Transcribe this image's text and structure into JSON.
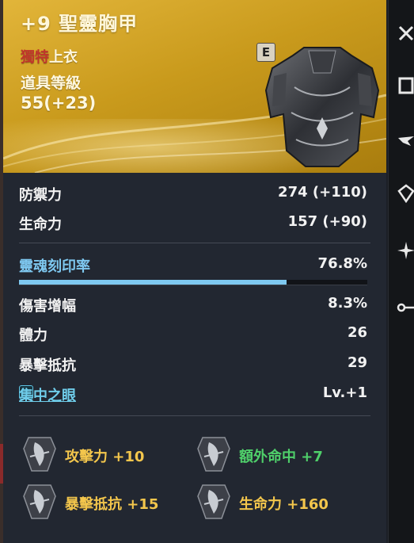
{
  "item": {
    "title": "+9 聖靈胸甲",
    "rarity": "獨特",
    "slot": "上衣",
    "level_label": "道具等級",
    "level_value": "55(+23)",
    "badge": "E"
  },
  "stats": [
    {
      "label": "防禦力",
      "value": "274 (+110)"
    },
    {
      "label": "生命力",
      "value": "157 (+90)"
    }
  ],
  "soul": {
    "label": "靈魂刻印率",
    "value": "76.8%",
    "progress": 0.768
  },
  "options": [
    {
      "label": "傷害增幅",
      "value": "8.3%"
    },
    {
      "label": "體力",
      "value": "26"
    },
    {
      "label": "暴擊抵抗",
      "value": "29"
    }
  ],
  "skill": {
    "label": "集中之眼",
    "value": "Lv.+1",
    "icon": "focus-skill-icon"
  },
  "bonuses": [
    {
      "text": "攻擊力 +10",
      "color": "#f3c64c"
    },
    {
      "text": "額外命中 +7",
      "color": "#4fd06a"
    },
    {
      "text": "暴擊抵抗 +15",
      "color": "#f3c64c"
    },
    {
      "text": "生命力 +160",
      "color": "#f3c64c"
    }
  ],
  "colors": {
    "header_gold": "#c99a1c",
    "soul_blue": "#7ec8f0",
    "bonus_gold": "#f3c64c",
    "bonus_green": "#4fd06a"
  }
}
